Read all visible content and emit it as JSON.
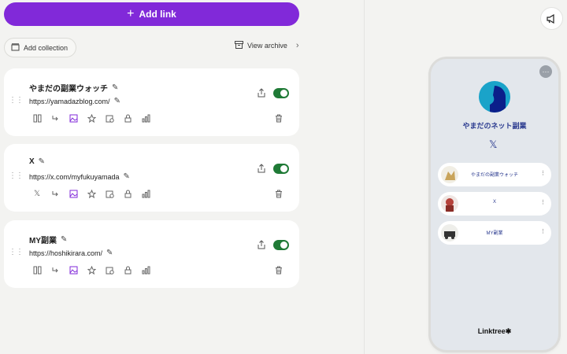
{
  "toolbar": {
    "add_link_label": "Add link",
    "add_collection_label": "Add collection",
    "view_archive_label": "View archive"
  },
  "links": [
    {
      "title": "やまだの副業ウォッチ",
      "url": "https://yamadazblog.com/",
      "enabled": true
    },
    {
      "title": "X",
      "url": "https://x.com/myfukuyamada",
      "enabled": true
    },
    {
      "title": "MY副業",
      "url": "https://hoshikirara.com/",
      "enabled": true
    }
  ],
  "preview": {
    "profile_name": "やまだのネット副業",
    "links": [
      "やまだの副業ウォッチ",
      "X",
      "MY副業"
    ],
    "brand": "Linktree✱"
  },
  "colors": {
    "accent": "#8129d9",
    "toggle_on": "#1f7a36",
    "link_text": "#2a3a8f"
  },
  "icons": [
    "plus-icon",
    "collection-icon",
    "archive-icon",
    "chevron-right-icon",
    "drag-handle-icon",
    "pencil-icon",
    "layout-icon",
    "redirect-icon",
    "thumbnail-icon",
    "star-icon",
    "schedule-icon",
    "lock-icon",
    "analytics-icon",
    "share-icon",
    "trash-icon",
    "megaphone-icon",
    "x-logo-icon",
    "more-icon"
  ]
}
